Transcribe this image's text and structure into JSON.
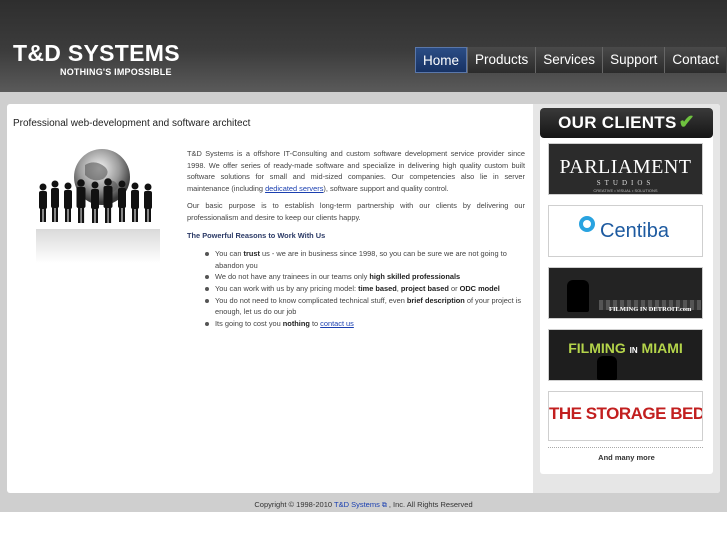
{
  "brand": {
    "title": "T&D SYSTEMS",
    "tagline": "NOTHING'S IMPOSSIBLE"
  },
  "nav": {
    "items": [
      "Home",
      "Products",
      "Services",
      "Support",
      "Contact"
    ],
    "active": "Home"
  },
  "main": {
    "title": "Professional web-development and software architect",
    "p1_a": "T&D Systems is a offshore IT-Consulting and custom software development service provider since 1998. We offer series of ready-made software and specialize in delivering high quality custom built software solutions for small and mid-sized companies. Our competencies also lie in server maintenance (including ",
    "p1_link": "dedicated servers",
    "p1_b": "), software support and quality control.",
    "p2": "Our basic purpose is to establish long-term partnership with our clients by delivering our professionalism and desire to keep our clients happy.",
    "reasons_heading": "The Powerful Reasons to Work With Us",
    "reasons": [
      {
        "pre": "You can ",
        "bold": "trust",
        "post": " us - we are in business since 1998, so you can be sure we are not going to abandon you"
      },
      {
        "pre": "We do not have any trainees in our teams only ",
        "bold": "high skilled professionals",
        "post": ""
      },
      {
        "pre": "You can work with us by any pricing model: ",
        "bold": "time based",
        "mid": ", ",
        "bold2": "project based",
        "mid2": " or ",
        "bold3": "ODC model",
        "post": ""
      },
      {
        "pre": "You do not need to know complicated technical stuff, even ",
        "bold": "brief description",
        "post": " of your project is enough, let us do our job"
      },
      {
        "pre": "Its going to cost you ",
        "bold": "nothing",
        "post": " to ",
        "link": "contact us"
      }
    ]
  },
  "clients": {
    "header": "OUR CLIENTS",
    "logos": [
      {
        "big": "PARLIAMENT",
        "small": "STUDIOS",
        "tiny": "CREATIVE • VISUAL • SOLUTIONS"
      },
      {
        "big": "Centiba"
      },
      {
        "big": "FILMING IN DETROIT.com"
      },
      {
        "big": "FILMING",
        "in": "IN",
        "big2": "MIAMI"
      },
      {
        "big": "THE STORAGE BED"
      }
    ],
    "more": "And many more"
  },
  "footer": {
    "pre": "Copyright © 1998-2010 ",
    "link": "T&D Systems",
    "post": ", Inc. All Rights Reserved"
  },
  "colors": {
    "nav_active": "#1f3c73",
    "link": "#1a3fb0",
    "check": "#6ec23f",
    "storage_red": "#c21f1f",
    "miami_green": "#b4d44a",
    "centiba_blue": "#1d5aa0"
  }
}
